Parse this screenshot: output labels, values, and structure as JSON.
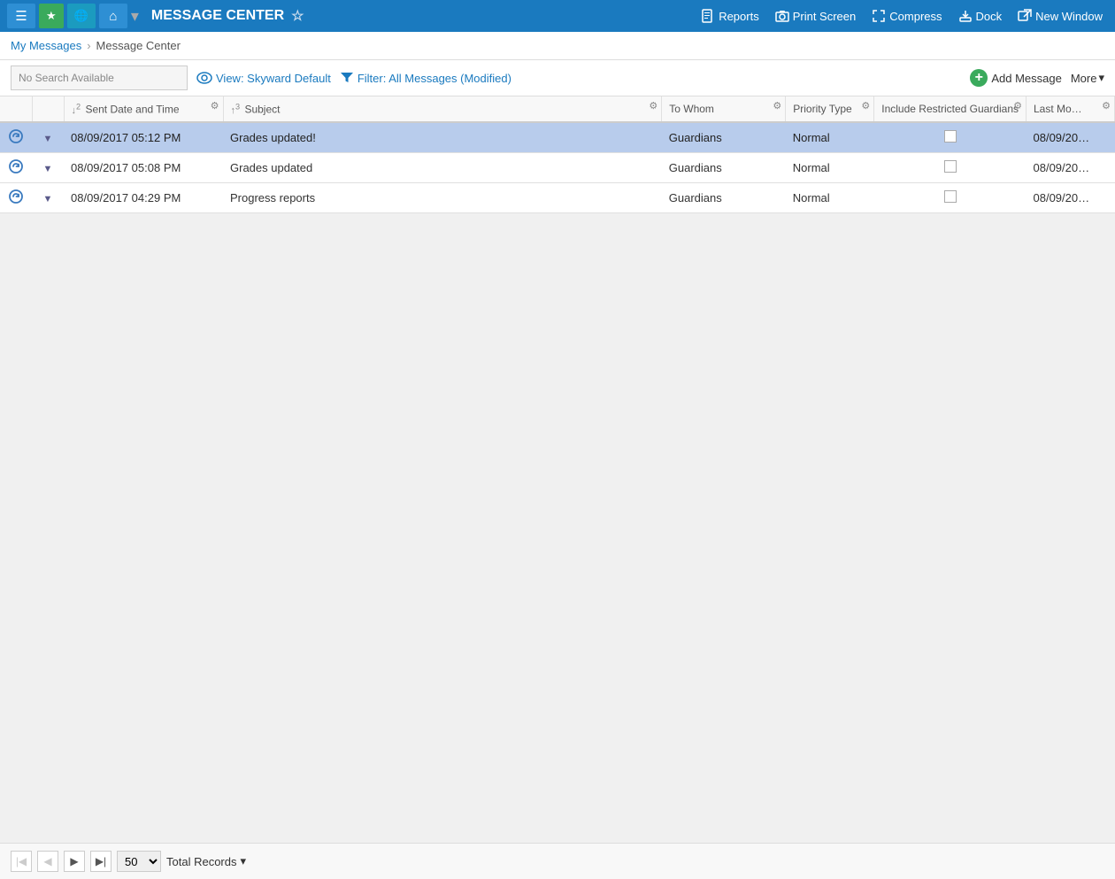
{
  "header": {
    "menu_label": "☰",
    "favorites_label": "★",
    "globe_label": "🌐",
    "home_label": "⌂",
    "title": "MESSAGE CENTER",
    "star_label": "☆",
    "reports_label": "Reports",
    "print_screen_label": "Print Screen",
    "compress_label": "Compress",
    "dock_label": "Dock",
    "new_window_label": "New Window"
  },
  "breadcrumb": {
    "parent": "My Messages",
    "current": "Message Center"
  },
  "toolbar": {
    "search_label": "No Search Available",
    "view_label": "View: Skyward Default",
    "filter_label": "Filter: All Messages (Modified)",
    "add_message_label": "Add Message",
    "more_label": "More"
  },
  "table": {
    "columns": [
      {
        "id": "icon",
        "label": "",
        "sort": "",
        "has_gear": false
      },
      {
        "id": "expand",
        "label": "",
        "sort": "",
        "has_gear": false
      },
      {
        "id": "sent_date",
        "label": "Sent Date and Time",
        "sort": "↓2",
        "has_gear": true
      },
      {
        "id": "subject",
        "label": "Subject",
        "sort": "↑3",
        "has_gear": true
      },
      {
        "id": "to_whom",
        "label": "To Whom",
        "sort": "",
        "has_gear": true
      },
      {
        "id": "priority_type",
        "label": "Priority Type",
        "sort": "",
        "has_gear": true
      },
      {
        "id": "include_restricted",
        "label": "Include Restricted Guardians",
        "sort": "",
        "has_gear": true
      },
      {
        "id": "last_mod",
        "label": "Last Mo…",
        "sort": "",
        "has_gear": true
      }
    ],
    "rows": [
      {
        "selected": true,
        "sent_date": "08/09/2017 05:12 PM",
        "subject": "Grades updated!",
        "to_whom": "Guardians",
        "priority_type": "Normal",
        "include_restricted": false,
        "last_mod": "08/09/20…"
      },
      {
        "selected": false,
        "sent_date": "08/09/2017 05:08 PM",
        "subject": "Grades updated",
        "to_whom": "Guardians",
        "priority_type": "Normal",
        "include_restricted": false,
        "last_mod": "08/09/20…"
      },
      {
        "selected": false,
        "sent_date": "08/09/2017 04:29 PM",
        "subject": "Progress reports",
        "to_whom": "Guardians",
        "priority_type": "Normal",
        "include_restricted": false,
        "last_mod": "08/09/20…"
      }
    ]
  },
  "footer": {
    "page_size": "50",
    "total_records_label": "Total Records"
  }
}
